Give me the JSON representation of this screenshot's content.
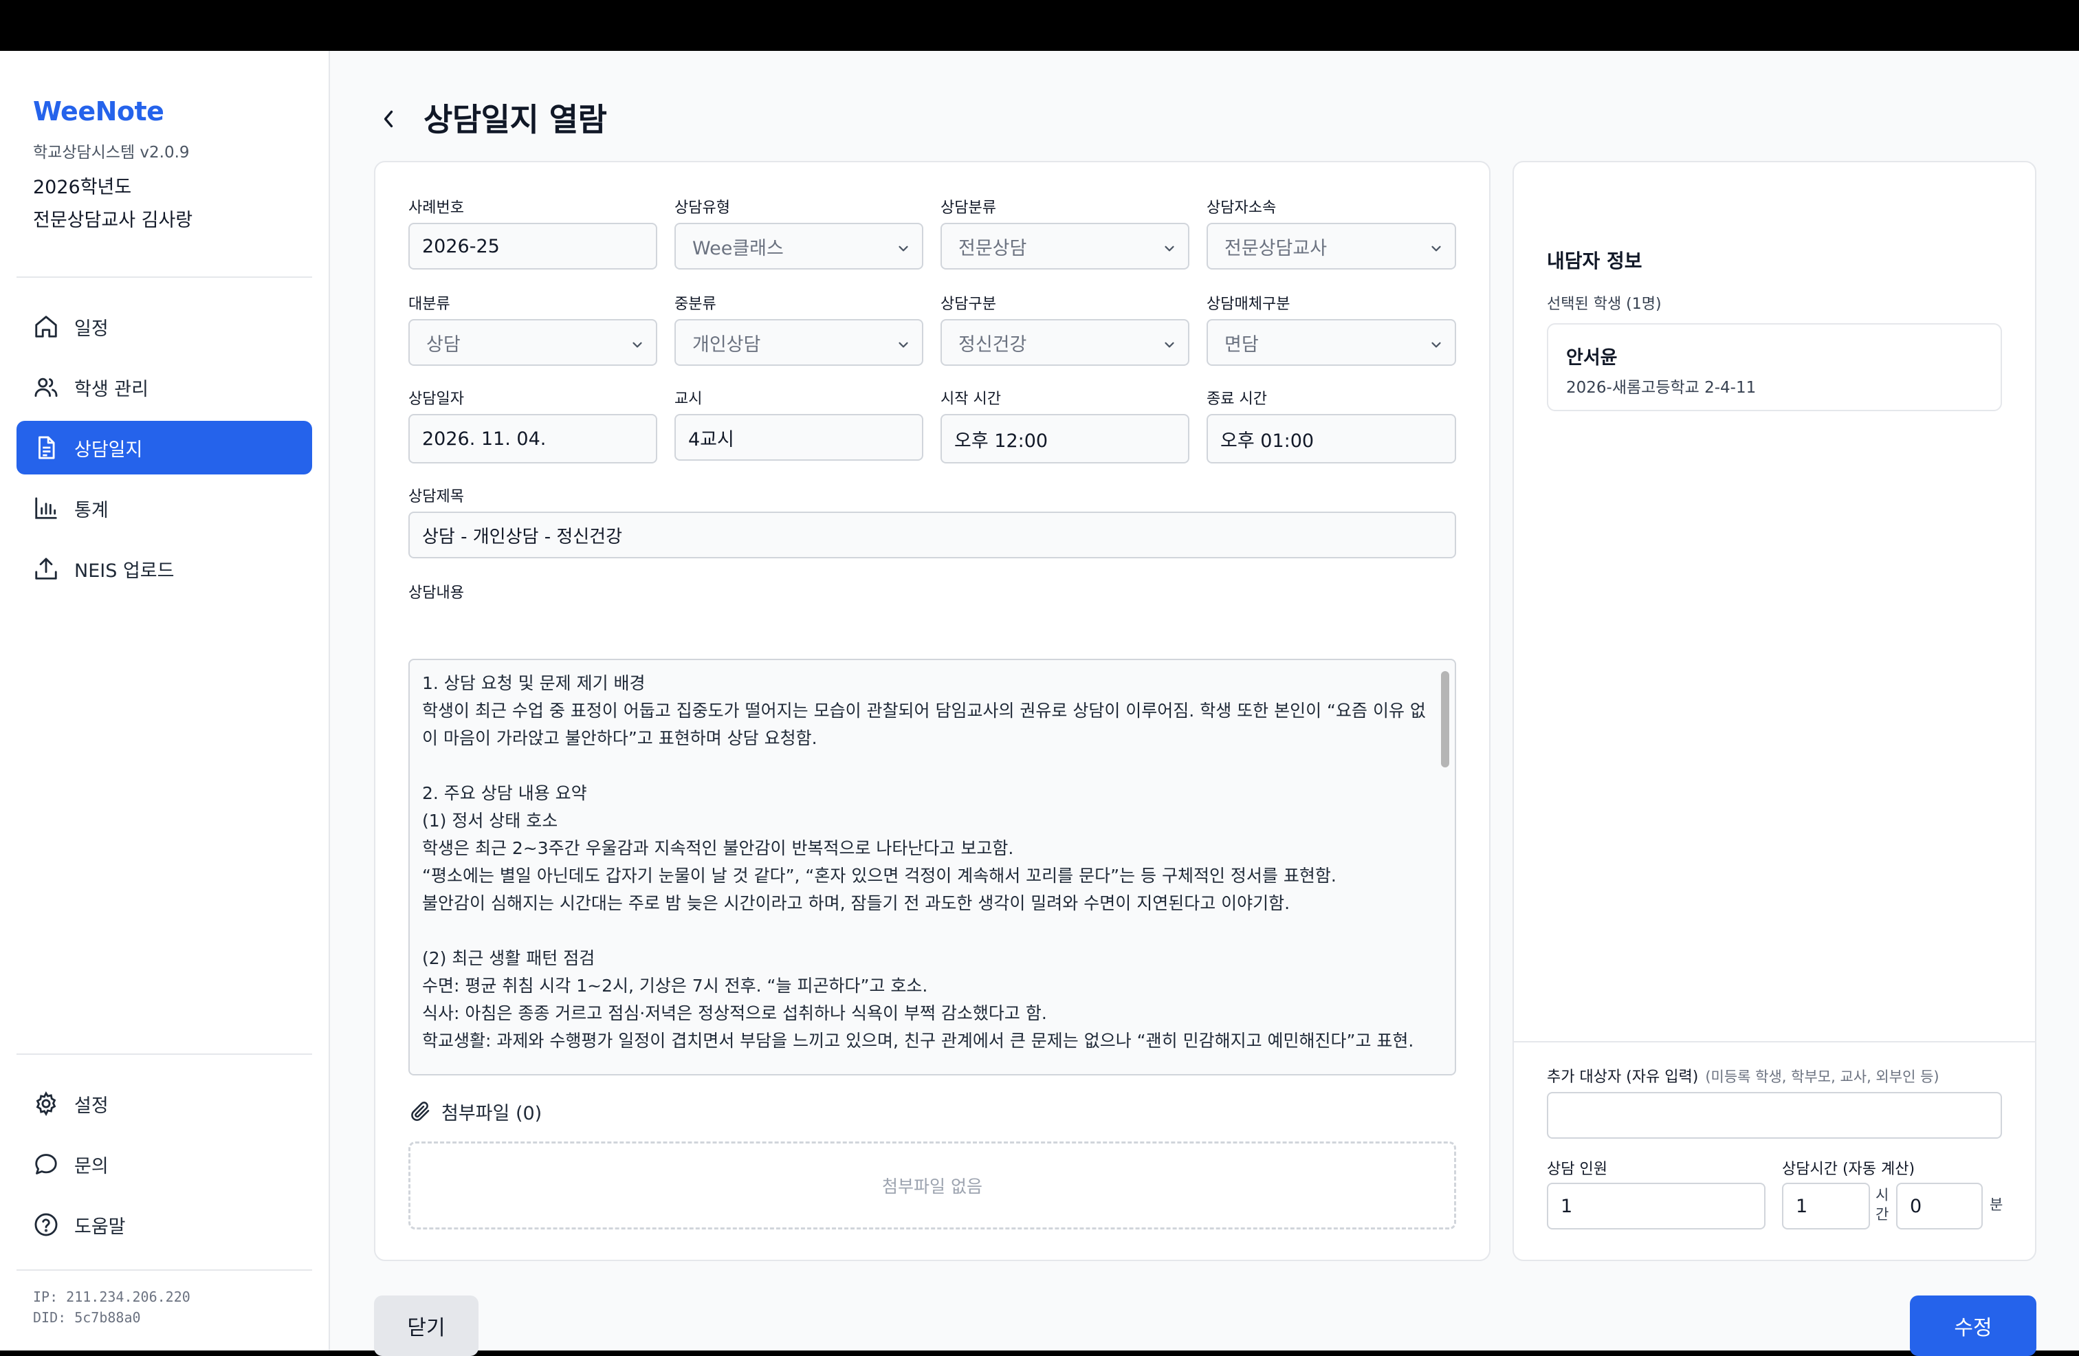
{
  "app": {
    "brand": "WeeNote",
    "version": "학교상담시스템 v2.0.9",
    "year": "2026학년도",
    "teacher": "전문상담교사 김사랑"
  },
  "nav": {
    "items": [
      {
        "label": "일정",
        "icon": "home-icon"
      },
      {
        "label": "학생 관리",
        "icon": "users-icon"
      },
      {
        "label": "상담일지",
        "icon": "document-icon",
        "active": true
      },
      {
        "label": "통계",
        "icon": "bar-chart-icon"
      },
      {
        "label": "NEIS 업로드",
        "icon": "upload-icon"
      }
    ],
    "bottom": [
      {
        "label": "설정",
        "icon": "gear-icon"
      },
      {
        "label": "문의",
        "icon": "chat-bubble-icon"
      },
      {
        "label": "도움말",
        "icon": "help-circle-icon"
      }
    ]
  },
  "sysinfo": {
    "ip": "IP: 211.234.206.220",
    "did": "DID: 5c7b88a0"
  },
  "page": {
    "title": "상담일지 열람"
  },
  "form": {
    "case_no": {
      "label": "사례번호",
      "value": "2026-25"
    },
    "type": {
      "label": "상담유형",
      "value": "Wee클래스"
    },
    "category": {
      "label": "상담분류",
      "value": "전문상담"
    },
    "affiliation": {
      "label": "상담자소속",
      "value": "전문상담교사"
    },
    "major": {
      "label": "대분류",
      "value": "상담"
    },
    "middle": {
      "label": "중분류",
      "value": "개인상담"
    },
    "division": {
      "label": "상담구분",
      "value": "정신건강"
    },
    "medium": {
      "label": "상담매체구분",
      "value": "면담"
    },
    "date": {
      "label": "상담일자",
      "value": "2026. 11. 04."
    },
    "period": {
      "label": "교시",
      "value": "4교시"
    },
    "start_time": {
      "label": "시작 시간",
      "value": "오후 12:00"
    },
    "end_time": {
      "label": "종료 시간",
      "value": "오후 01:00"
    },
    "subject": {
      "label": "상담제목",
      "value": "상담 - 개인상담 - 정신건강"
    },
    "content": {
      "label": "상담내용",
      "value": "1. 상담 요청 및 문제 제기 배경\n학생이 최근 수업 중 표정이 어둡고 집중도가 떨어지는 모습이 관찰되어 담임교사의 권유로 상담이 이루어짐. 학생 또한 본인이 “요즘 이유 없이 마음이 가라앉고 불안하다”고 표현하며 상담 요청함.\n\n2. 주요 상담 내용 요약\n(1) 정서 상태 호소\n학생은 최근 2~3주간 우울감과 지속적인 불안감이 반복적으로 나타난다고 보고함.\n“평소에는 별일 아닌데도 갑자기 눈물이 날 것 같다”, “혼자 있으면 걱정이 계속해서 꼬리를 문다”는 등 구체적인 정서를 표현함.\n불안감이 심해지는 시간대는 주로 밤 늦은 시간이라고 하며, 잠들기 전 과도한 생각이 밀려와 수면이 지연된다고 이야기함.\n\n(2) 최근 생활 패턴 점검\n수면: 평균 취침 시각 1~2시, 기상은 7시 전후. “늘 피곤하다”고 호소.\n식사: 아침은 종종 거르고 점심·저녁은 정상적으로 섭취하나 식욕이 부쩍 감소했다고 함.\n학교생활: 과제와 수행평가 일정이 겹치면서 부담을 느끼고 있으며, 친구 관계에서 큰 문제는 없으나 “괜히 민감해지고 예민해진다”고 표현."
    }
  },
  "attachments": {
    "label": "첨부파일 (0)",
    "empty": "첨부파일 없음"
  },
  "client": {
    "title": "내담자 정보",
    "selected_label": "선택된 학생 (1명)",
    "student": {
      "name": "안서윤",
      "info": "2026-새롬고등학교 2-4-11"
    },
    "extra_label": "추가 대상자 (자유 입력)",
    "extra_hint": "(미등록 학생, 학부모, 교사, 외부인 등)",
    "extra_value": "",
    "count_label": "상담 인원",
    "count_value": "1",
    "duration_label": "상담시간 (자동 계산)",
    "hours": "1",
    "hours_unit_1": "시",
    "hours_unit_2": "간",
    "minutes": "0",
    "minutes_unit": "분"
  },
  "buttons": {
    "close": "닫기",
    "edit": "수정"
  },
  "colors": {
    "accent": "#2563eb",
    "border": "#d1d5db"
  }
}
